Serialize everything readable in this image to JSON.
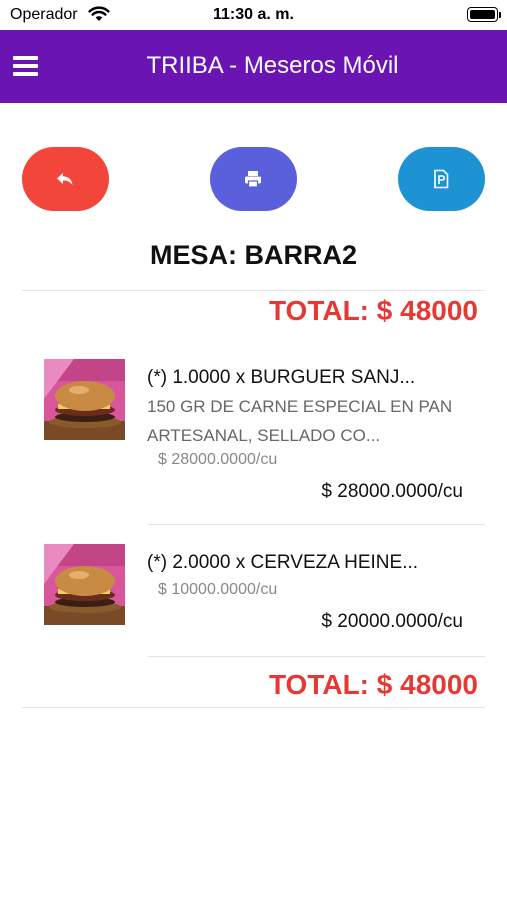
{
  "status_bar": {
    "carrier": "Operador",
    "time": "11:30 a. m."
  },
  "header": {
    "title": "TRIIBA - Meseros Móvil"
  },
  "actions": [
    {
      "icon": "reply-icon",
      "color": "#f2463a"
    },
    {
      "icon": "printer-icon",
      "color": "#5a5fdb"
    },
    {
      "icon": "pdf-file-icon",
      "color": "#1d93d4"
    }
  ],
  "table": {
    "label": "MESA: BARRA2"
  },
  "total_label": "TOTAL: $ 48000",
  "items": [
    {
      "title": "(*) 1.0000 x BURGUER SANJ...",
      "description": "150 GR DE CARNE ESPECIAL EN PAN ARTESANAL, SELLADO CO...",
      "unit_price": "$ 28000.0000/cu",
      "subtotal": "$ 28000.0000/cu"
    },
    {
      "title": "(*) 2.0000 x CERVEZA HEINE...",
      "description": "",
      "unit_price": "$ 10000.0000/cu",
      "subtotal": "$ 20000.0000/cu"
    }
  ],
  "colors": {
    "header": "#6a14b3",
    "total": "#e53935"
  }
}
